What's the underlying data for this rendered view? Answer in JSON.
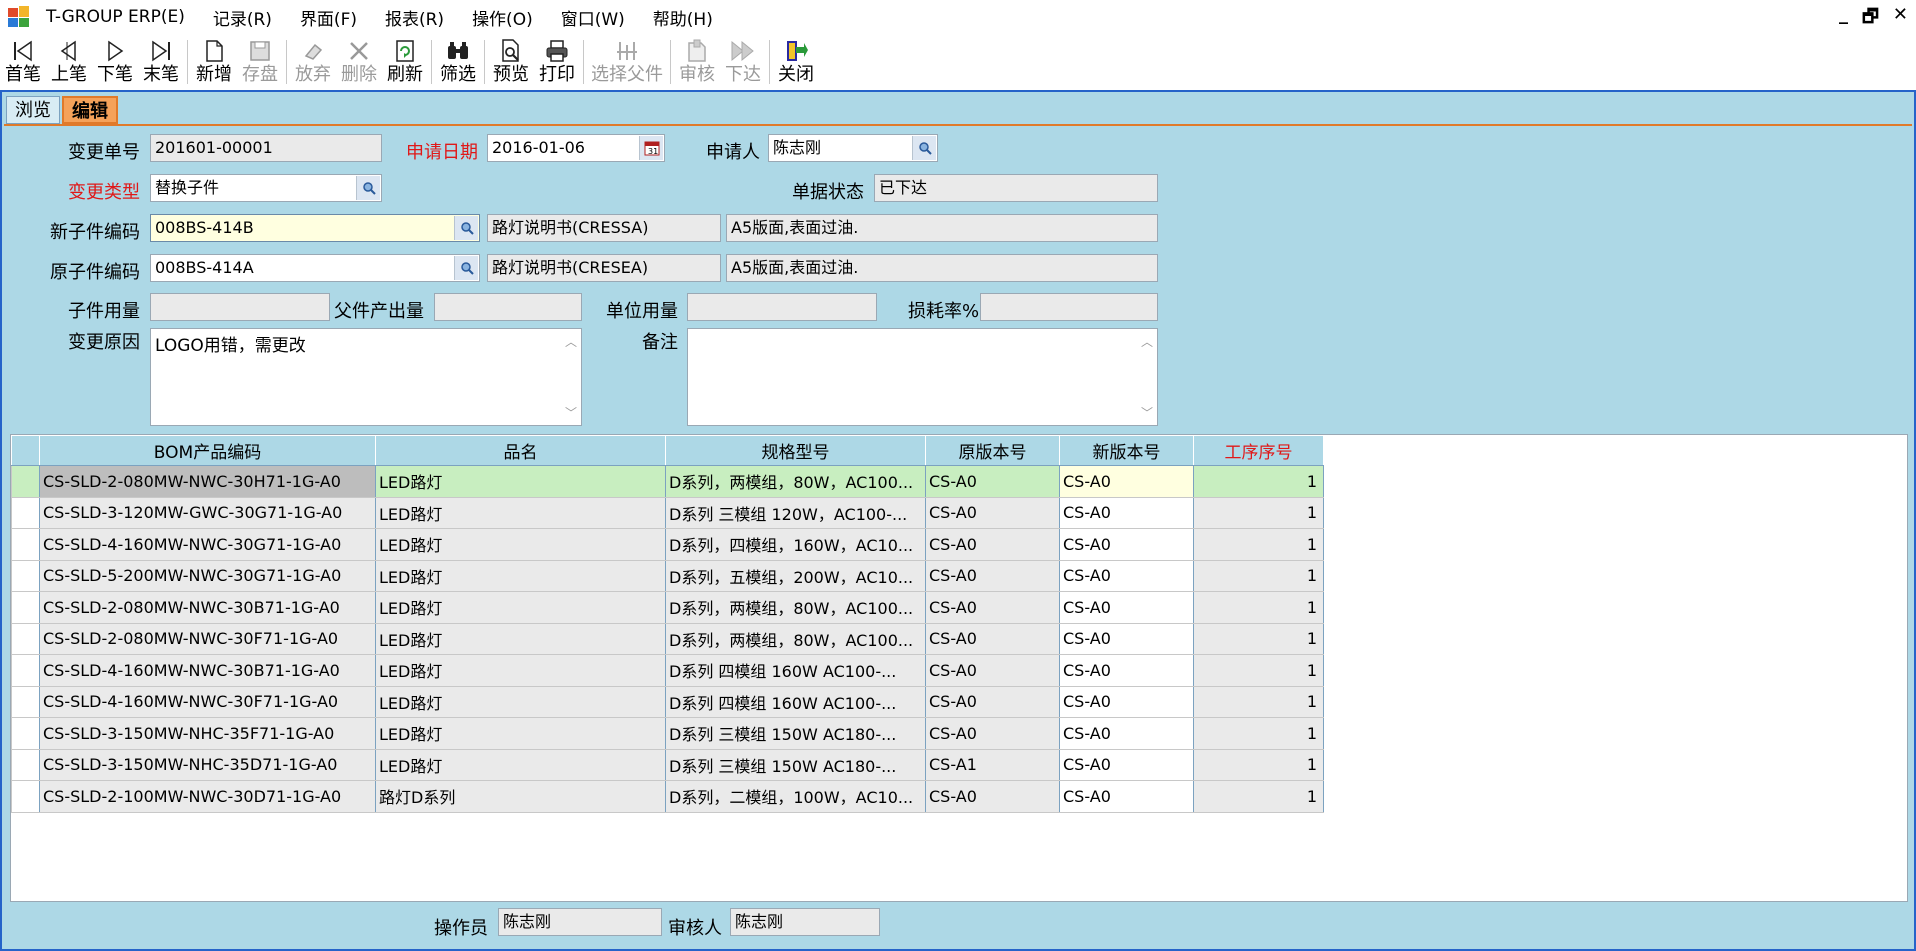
{
  "menubar": {
    "app_title": "T-GROUP ERP(E)",
    "items": [
      "记录(R)",
      "界面(F)",
      "报表(R)",
      "操作(O)",
      "窗口(W)",
      "帮助(H)"
    ],
    "controls": [
      "_",
      "🗗",
      "✕"
    ]
  },
  "toolbar": {
    "first": "首笔",
    "prev": "上笔",
    "next": "下笔",
    "last": "末笔",
    "new": "新增",
    "save": "存盘",
    "discard": "放弃",
    "delete": "删除",
    "refresh": "刷新",
    "filter": "筛选",
    "preview": "预览",
    "print": "打印",
    "select_parent": "选择父件",
    "audit": "审核",
    "issue": "下达",
    "close": "关闭"
  },
  "tabs": {
    "browse": "浏览",
    "edit": "编辑"
  },
  "form": {
    "change_no_label": "变更单号",
    "change_no": "201601-00001",
    "apply_date_label": "申请日期",
    "apply_date": "2016-01-06",
    "applicant_label": "申请人",
    "applicant": "陈志刚",
    "change_type_label": "变更类型",
    "change_type": "替换子件",
    "doc_status_label": "单据状态",
    "doc_status": "已下达",
    "new_part_label": "新子件编码",
    "new_part_code": "008BS-414B",
    "new_part_name": "路灯说明书(CRESSA)",
    "new_part_spec": "A5版面,表面过油.",
    "old_part_label": "原子件编码",
    "old_part_code": "008BS-414A",
    "old_part_name": "路灯说明书(CRESEA)",
    "old_part_spec": "A5版面,表面过油.",
    "qty_label": "子件用量",
    "qty": "",
    "parent_output_label": "父件产出量",
    "parent_output": "",
    "unit_qty_label": "单位用量",
    "unit_qty": "",
    "loss_rate_label": "损耗率%",
    "loss_rate": "",
    "reason_label": "变更原因",
    "reason": "LOGO用错，需更改",
    "remark_label": "备注",
    "remark": ""
  },
  "grid": {
    "headers": {
      "code": "BOM产品编码",
      "name": "品名",
      "spec": "规格型号",
      "old_ver": "原版本号",
      "new_ver": "新版本号",
      "seq": "工序序号"
    },
    "rows": [
      {
        "code": "CS-SLD-2-080MW-NWC-30H71-1G-A0",
        "name": "LED路灯",
        "spec": "D系列，两模组，80W，AC100...",
        "old_ver": "CS-A0",
        "new_ver": "CS-A0",
        "seq": "1"
      },
      {
        "code": "CS-SLD-3-120MW-GWC-30G71-1G-A0",
        "name": "LED路灯",
        "spec": "D系列 三模组 120W，AC100-...",
        "old_ver": "CS-A0",
        "new_ver": "CS-A0",
        "seq": "1"
      },
      {
        "code": "CS-SLD-4-160MW-NWC-30G71-1G-A0",
        "name": "LED路灯",
        "spec": "D系列，四模组，160W，AC10...",
        "old_ver": "CS-A0",
        "new_ver": "CS-A0",
        "seq": "1"
      },
      {
        "code": "CS-SLD-5-200MW-NWC-30G71-1G-A0",
        "name": "LED路灯",
        "spec": "D系列，五模组，200W，AC10...",
        "old_ver": "CS-A0",
        "new_ver": "CS-A0",
        "seq": "1"
      },
      {
        "code": "CS-SLD-2-080MW-NWC-30B71-1G-A0",
        "name": "LED路灯",
        "spec": "D系列，两模组，80W，AC100...",
        "old_ver": "CS-A0",
        "new_ver": "CS-A0",
        "seq": "1"
      },
      {
        "code": "CS-SLD-2-080MW-NWC-30F71-1G-A0",
        "name": "LED路灯",
        "spec": "D系列，两模组，80W，AC100...",
        "old_ver": "CS-A0",
        "new_ver": "CS-A0",
        "seq": "1"
      },
      {
        "code": "CS-SLD-4-160MW-NWC-30B71-1G-A0",
        "name": "LED路灯",
        "spec": "D系列 四模组 160W AC100-...",
        "old_ver": "CS-A0",
        "new_ver": "CS-A0",
        "seq": "1"
      },
      {
        "code": "CS-SLD-4-160MW-NWC-30F71-1G-A0",
        "name": "LED路灯",
        "spec": "D系列 四模组 160W AC100-...",
        "old_ver": "CS-A0",
        "new_ver": "CS-A0",
        "seq": "1"
      },
      {
        "code": "CS-SLD-3-150MW-NHC-35F71-1G-A0",
        "name": "LED路灯",
        "spec": "D系列 三模组 150W AC180-...",
        "old_ver": "CS-A0",
        "new_ver": "CS-A0",
        "seq": "1"
      },
      {
        "code": "CS-SLD-3-150MW-NHC-35D71-1G-A0",
        "name": "LED路灯",
        "spec": "D系列 三模组 150W AC180-...",
        "old_ver": "CS-A1",
        "new_ver": "CS-A0",
        "seq": "1"
      },
      {
        "code": "CS-SLD-2-100MW-NWC-30D71-1G-A0",
        "name": "路灯D系列",
        "spec": "D系列，二模组，100W，AC10...",
        "old_ver": "CS-A0",
        "new_ver": "CS-A0",
        "seq": "1"
      }
    ]
  },
  "footer": {
    "operator_label": "操作员",
    "operator": "陈志刚",
    "auditor_label": "审核人",
    "auditor": "陈志刚"
  },
  "colors": {
    "frame_bg": "#add8e6",
    "accent_tab": "#f5a25a",
    "required_label": "#e01818",
    "selected_row": "#c8eec0"
  }
}
